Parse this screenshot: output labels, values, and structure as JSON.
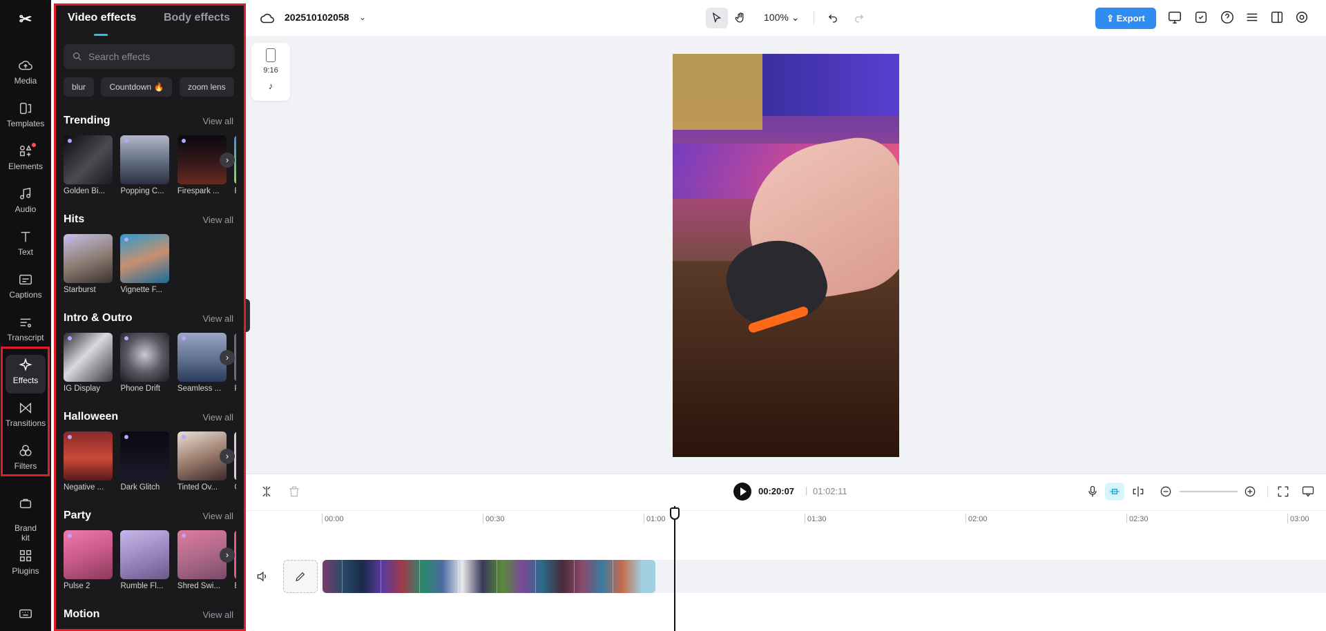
{
  "rail": {
    "items": [
      {
        "label": "Media",
        "icon": "cloud-upload-icon"
      },
      {
        "label": "Templates",
        "icon": "templates-icon"
      },
      {
        "label": "Elements",
        "icon": "elements-icon"
      },
      {
        "label": "Audio",
        "icon": "music-note-icon"
      },
      {
        "label": "Text",
        "icon": "text-t-icon"
      },
      {
        "label": "Captions",
        "icon": "captions-icon"
      },
      {
        "label": "Transcript",
        "icon": "transcript-icon"
      },
      {
        "label": "Effects",
        "icon": "sparkle-icon"
      },
      {
        "label": "Transitions",
        "icon": "bowtie-icon"
      },
      {
        "label": "Filters",
        "icon": "circles-icon"
      },
      {
        "label": "Brand\nkit",
        "icon": "briefcase-icon"
      },
      {
        "label": "Plugins",
        "icon": "grid-icon"
      }
    ],
    "active": "Effects"
  },
  "panel": {
    "tab_video": "Video effects",
    "tab_body": "Body effects",
    "search_placeholder": "Search effects",
    "chips": [
      "blur",
      "Countdown 🔥",
      "zoom lens"
    ],
    "view_all": "View all",
    "sections": [
      {
        "title": "Trending",
        "items": [
          "Golden Bi...",
          "Popping C...",
          "Firespark ...",
          "Fl"
        ]
      },
      {
        "title": "Hits",
        "items": [
          "Starburst",
          "Vignette F..."
        ]
      },
      {
        "title": "Intro & Outro",
        "items": [
          "IG Display",
          "Phone Drift",
          "Seamless ...",
          "Pl"
        ]
      },
      {
        "title": "Halloween",
        "items": [
          "Negative ...",
          "Dark Glitch",
          "Tinted Ov...",
          "C"
        ]
      },
      {
        "title": "Party",
        "items": [
          "Pulse 2",
          "Rumble Fl...",
          "Shred Swi...",
          "Be"
        ]
      },
      {
        "title": "Motion",
        "items": []
      }
    ]
  },
  "topbar": {
    "project_name": "202510102058",
    "zoom": "100%",
    "export_label": "Export"
  },
  "canvas": {
    "ratio": "9:16"
  },
  "timeline": {
    "current_time": "00:20:07",
    "separator": "|",
    "total_time": "01:02:11",
    "ticks": [
      "00:00",
      "00:30",
      "01:00",
      "01:30",
      "02:00",
      "02:30",
      "03:00"
    ]
  },
  "colors": {
    "accent": "#25c5e8",
    "export": "#2f8cf0",
    "highlight_box": "#e11d2a"
  }
}
